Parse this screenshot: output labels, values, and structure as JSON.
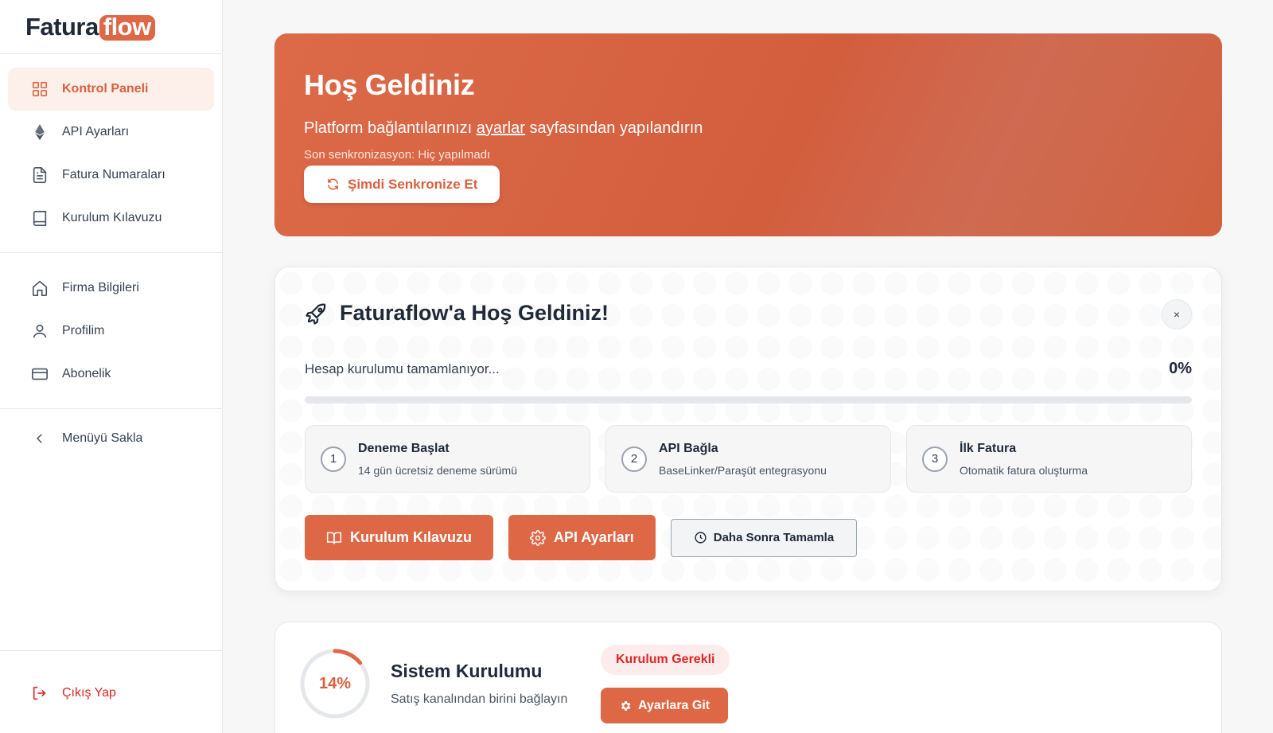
{
  "brand": {
    "name_main": "Fatura",
    "name_accent": "flow",
    "accent_color": "#de6845"
  },
  "sidebar": {
    "primary": [
      {
        "label": "Kontrol Paneli",
        "icon": "dashboard-grid-icon",
        "active": true
      },
      {
        "label": "API Ayarları",
        "icon": "ethereum-icon"
      },
      {
        "label": "Fatura Numaraları",
        "icon": "document-icon"
      },
      {
        "label": "Kurulum Kılavuzu",
        "icon": "book-icon"
      }
    ],
    "secondary": [
      {
        "label": "Firma Bilgileri",
        "icon": "home-icon"
      },
      {
        "label": "Profilim",
        "icon": "user-icon"
      },
      {
        "label": "Abonelik",
        "icon": "credit-card-icon"
      }
    ],
    "collapse": {
      "label": "Menüyü Sakla",
      "icon": "chevron-left-icon"
    },
    "logout": {
      "label": "Çıkış Yap",
      "icon": "logout-icon"
    }
  },
  "hero": {
    "title": "Hoş Geldiniz",
    "subtitle_before": "Platform bağlantılarınızı ",
    "subtitle_link": "ayarlar",
    "subtitle_after": " sayfasından yapılandırın",
    "last_sync": "Son senkronizasyon: Hiç yapılmadı",
    "sync_button": "Şimdi Senkronize Et"
  },
  "welcome": {
    "title": "Faturaflow'a Hoş Geldiniz!",
    "close": "×",
    "progress_label": "Hesap kurulumu tamamlanıyor...",
    "progress_text": "0%",
    "progress_value": 0,
    "steps": [
      {
        "number": "1",
        "title": "Deneme Başlat",
        "desc": "14 gün ücretsiz deneme sürümü"
      },
      {
        "number": "2",
        "title": "API Bağla",
        "desc": "BaseLinker/Paraşüt entegrasyonu"
      },
      {
        "number": "3",
        "title": "İlk Fatura",
        "desc": "Otomatik fatura oluşturma"
      }
    ],
    "buttons": {
      "guide": "Kurulum Kılavuzu",
      "api": "API Ayarları",
      "later": "Daha Sonra Tamamla"
    }
  },
  "setup": {
    "percent_text": "14%",
    "percent_value": 14,
    "title": "Sistem Kurulumu",
    "subtitle": "Satış kanalından birini bağlayın",
    "badge": "Kurulum Gerekli",
    "button": "Ayarlara Git"
  }
}
